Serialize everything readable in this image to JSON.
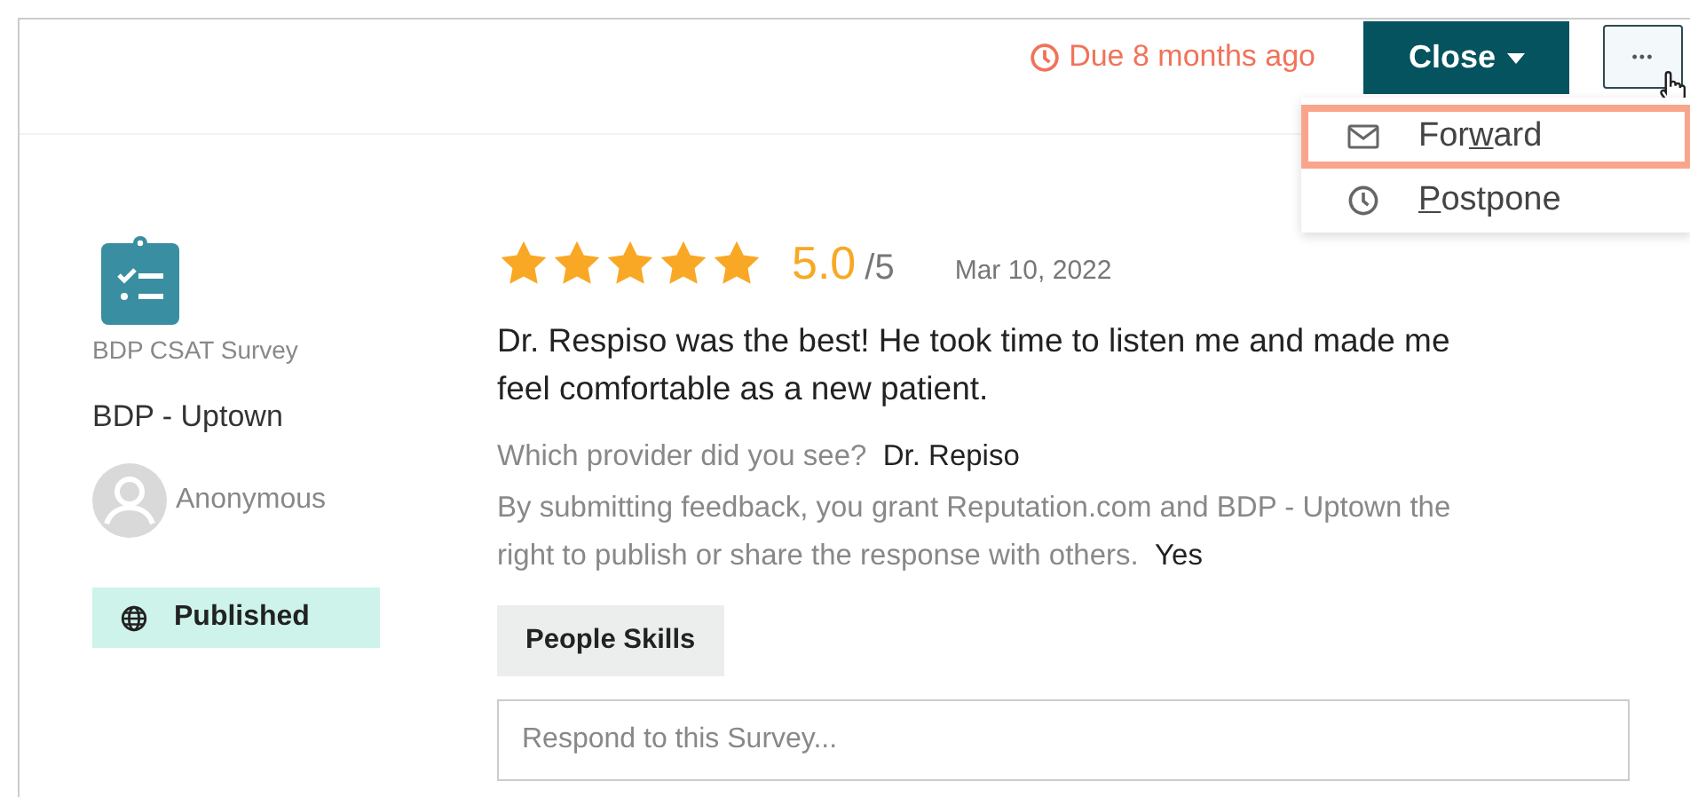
{
  "header": {
    "due": "Due 8 months ago",
    "close_button": "Close",
    "more_button": "•••"
  },
  "menu": {
    "items": [
      {
        "kind": "mail",
        "before": "For",
        "mnemonic": "w",
        "after": "ard",
        "selected": true
      },
      {
        "kind": "clock",
        "mnemonic": "P",
        "after": "ostpone",
        "selected": false
      }
    ]
  },
  "sidebar": {
    "survey_name": "BDP CSAT Survey",
    "location": "BDP - Uptown",
    "author": "Anonymous",
    "status": "Published"
  },
  "review": {
    "stars": 5,
    "score": "5.0",
    "scale": "/5",
    "date": "Mar 10, 2022",
    "text": "Dr. Respiso was the best! He took time to listen me and made me feel comfortable as a new patient.",
    "answers": [
      {
        "question": "Which provider did you see?",
        "answer": "Dr. Repiso"
      },
      {
        "question": "By submitting feedback, you grant Reputation.com and BDP - Uptown the right to publish or share the response with others.",
        "answer": "Yes"
      }
    ],
    "tags": [
      "People Skills"
    ],
    "response_placeholder": "Respond to this Survey..."
  }
}
